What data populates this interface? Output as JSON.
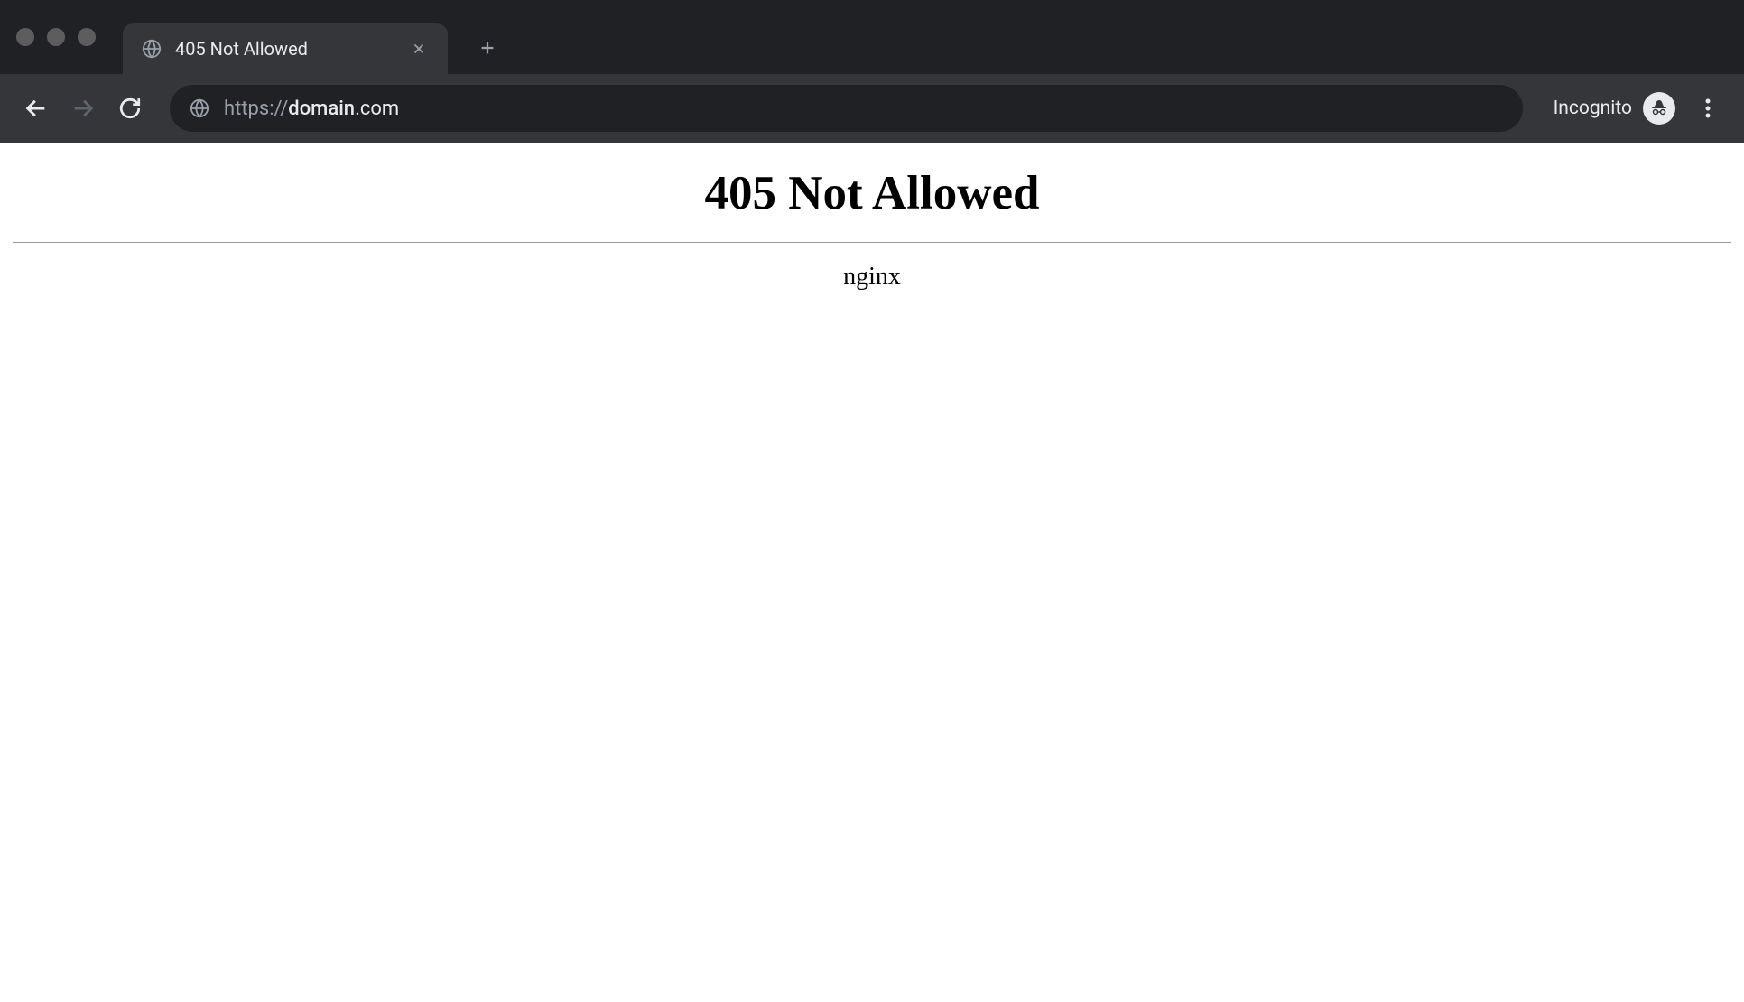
{
  "browser": {
    "tab": {
      "title": "405 Not Allowed"
    },
    "address_bar": {
      "protocol": "https://",
      "domain": "domain",
      "tld": ".com"
    },
    "incognito_label": "Incognito"
  },
  "page": {
    "heading": "405 Not Allowed",
    "server": "nginx"
  }
}
